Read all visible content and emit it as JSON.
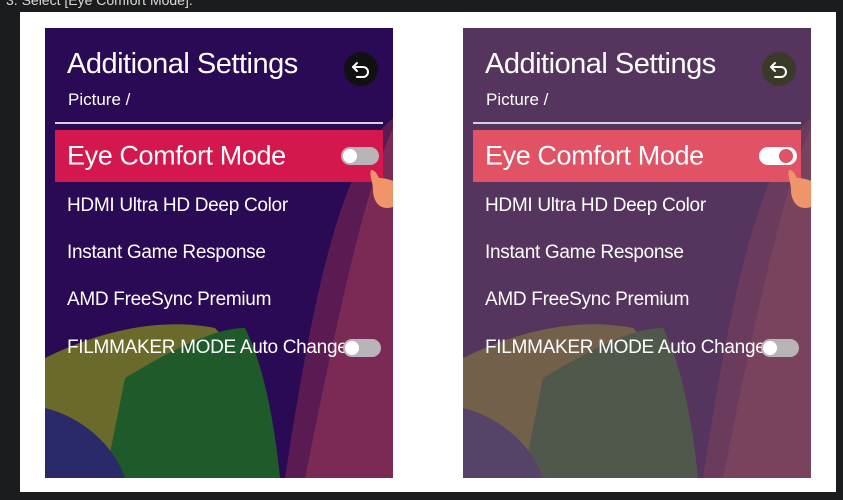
{
  "caption": "3. Select [Eye Comfort Mode].",
  "colors": {
    "selected_before": "#d4184d",
    "selected_after": "#e05264",
    "panel_bg_before": "#2a0a55",
    "panel_bg_after": "#6e5466"
  },
  "panels": [
    {
      "title": "Additional Settings",
      "breadcrumb": "Picture /",
      "back_icon": "back-arrow-icon",
      "items": [
        {
          "label": "Eye Comfort Mode",
          "selected": true,
          "toggle": "off"
        },
        {
          "label": "HDMI Ultra HD Deep Color"
        },
        {
          "label": "Instant Game Response"
        },
        {
          "label": "AMD FreeSync Premium"
        },
        {
          "label": "FILMMAKER MODE Auto Change",
          "toggle": "off"
        }
      ]
    },
    {
      "title": "Additional Settings",
      "breadcrumb": "Picture /",
      "back_icon": "back-arrow-icon",
      "items": [
        {
          "label": "Eye Comfort Mode",
          "selected": true,
          "toggle": "on"
        },
        {
          "label": "HDMI Ultra HD Deep Color"
        },
        {
          "label": "Instant Game Response"
        },
        {
          "label": "AMD FreeSync Premium"
        },
        {
          "label": "FILMMAKER MODE Auto Change",
          "toggle": "off"
        }
      ]
    }
  ],
  "arrow_icon": "chevron-right-icon",
  "pointer_icon": "hand-pointer-icon"
}
